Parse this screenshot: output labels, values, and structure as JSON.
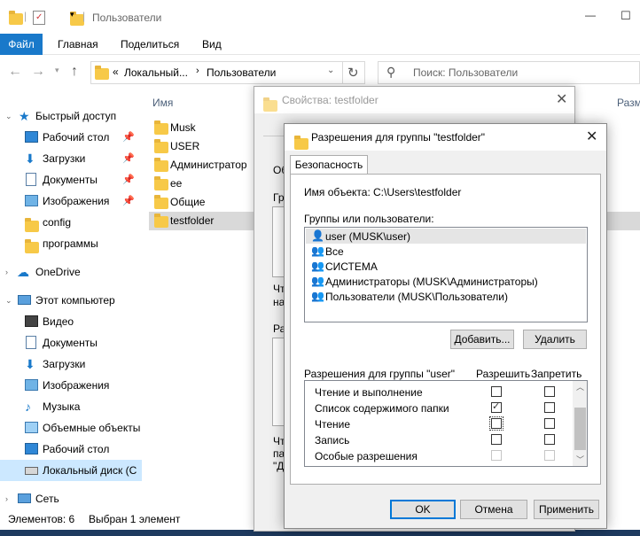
{
  "window": {
    "title": "Пользователи",
    "controls": {
      "minimize": "—",
      "maximize": "☐"
    }
  },
  "ribbon": {
    "tabs": [
      {
        "label": "Файл",
        "active": true
      },
      {
        "label": "Главная"
      },
      {
        "label": "Поделиться"
      },
      {
        "label": "Вид"
      }
    ],
    "accent": "#1979ca"
  },
  "address": {
    "prefix": "«",
    "crumbs": [
      "Локальный...",
      "Пользователи"
    ],
    "search_placeholder": "Поиск: Пользователи"
  },
  "columns": {
    "name": "Имя",
    "size": "Разм"
  },
  "sidebar": {
    "items": [
      {
        "label": "Быстрый доступ",
        "icon": "star-icon"
      },
      {
        "label": "Рабочий стол",
        "icon": "desktop-icon",
        "pinned": true
      },
      {
        "label": "Загрузки",
        "icon": "download-icon",
        "pinned": true
      },
      {
        "label": "Документы",
        "icon": "documents-icon",
        "pinned": true
      },
      {
        "label": "Изображения",
        "icon": "pictures-icon",
        "pinned": true
      },
      {
        "label": "config",
        "icon": "folder-icon"
      },
      {
        "label": "программы",
        "icon": "folder-icon"
      },
      {
        "label": "OneDrive",
        "icon": "cloud-icon"
      },
      {
        "label": "Этот компьютер",
        "icon": "computer-icon"
      },
      {
        "label": "Видео",
        "icon": "video-icon"
      },
      {
        "label": "Документы",
        "icon": "documents-icon"
      },
      {
        "label": "Загрузки",
        "icon": "download-icon"
      },
      {
        "label": "Изображения",
        "icon": "pictures-icon"
      },
      {
        "label": "Музыка",
        "icon": "music-icon"
      },
      {
        "label": "Объемные объекты",
        "icon": "3d-objects-icon"
      },
      {
        "label": "Рабочий стол",
        "icon": "desktop-icon"
      },
      {
        "label": "Локальный диск (C",
        "icon": "drive-icon",
        "selected": true
      },
      {
        "label": "Сеть",
        "icon": "network-icon"
      }
    ]
  },
  "files": [
    "Musk",
    "USER",
    "Администратор",
    "ee",
    "Общие",
    "testfolder"
  ],
  "status": {
    "count": "Элементов: 6",
    "selected": "Выбран 1 элемент"
  },
  "props_dialog": {
    "title": "Свойства: testfolder",
    "fragments": [
      "Об",
      "Гр",
      "Чт",
      "на",
      "Ра",
      "Чт",
      "па",
      "\"Д"
    ]
  },
  "perm_dialog": {
    "title": "Разрешения для группы \"testfolder\"",
    "tab": "Безопасность",
    "object_label": "Имя объекта:",
    "object_value": "C:\\Users\\testfolder",
    "groups_label": "Группы или пользователи:",
    "groups": [
      {
        "label": "user (MUSK\\user)",
        "selected": true
      },
      {
        "label": "Все"
      },
      {
        "label": "СИСТЕМА"
      },
      {
        "label": "Администраторы (MUSK\\Администраторы)"
      },
      {
        "label": "Пользователи (MUSK\\Пользователи)"
      }
    ],
    "add_button": "Добавить...",
    "remove_button": "Удалить",
    "perms_label": "Разрешения для группы \"user\"",
    "allow_col": "Разрешить",
    "deny_col": "Запретить",
    "perms": [
      {
        "label": "Чтение и выполнение",
        "allow": false,
        "deny": false
      },
      {
        "label": "Список содержимого папки",
        "allow": true,
        "deny": false
      },
      {
        "label": "Чтение",
        "allow": false,
        "deny": false
      },
      {
        "label": "Запись",
        "allow": false,
        "deny": false
      },
      {
        "label": "Особые разрешения",
        "allow": false,
        "deny": false
      }
    ],
    "ok": "OK",
    "cancel": "Отмена",
    "apply": "Применить"
  }
}
